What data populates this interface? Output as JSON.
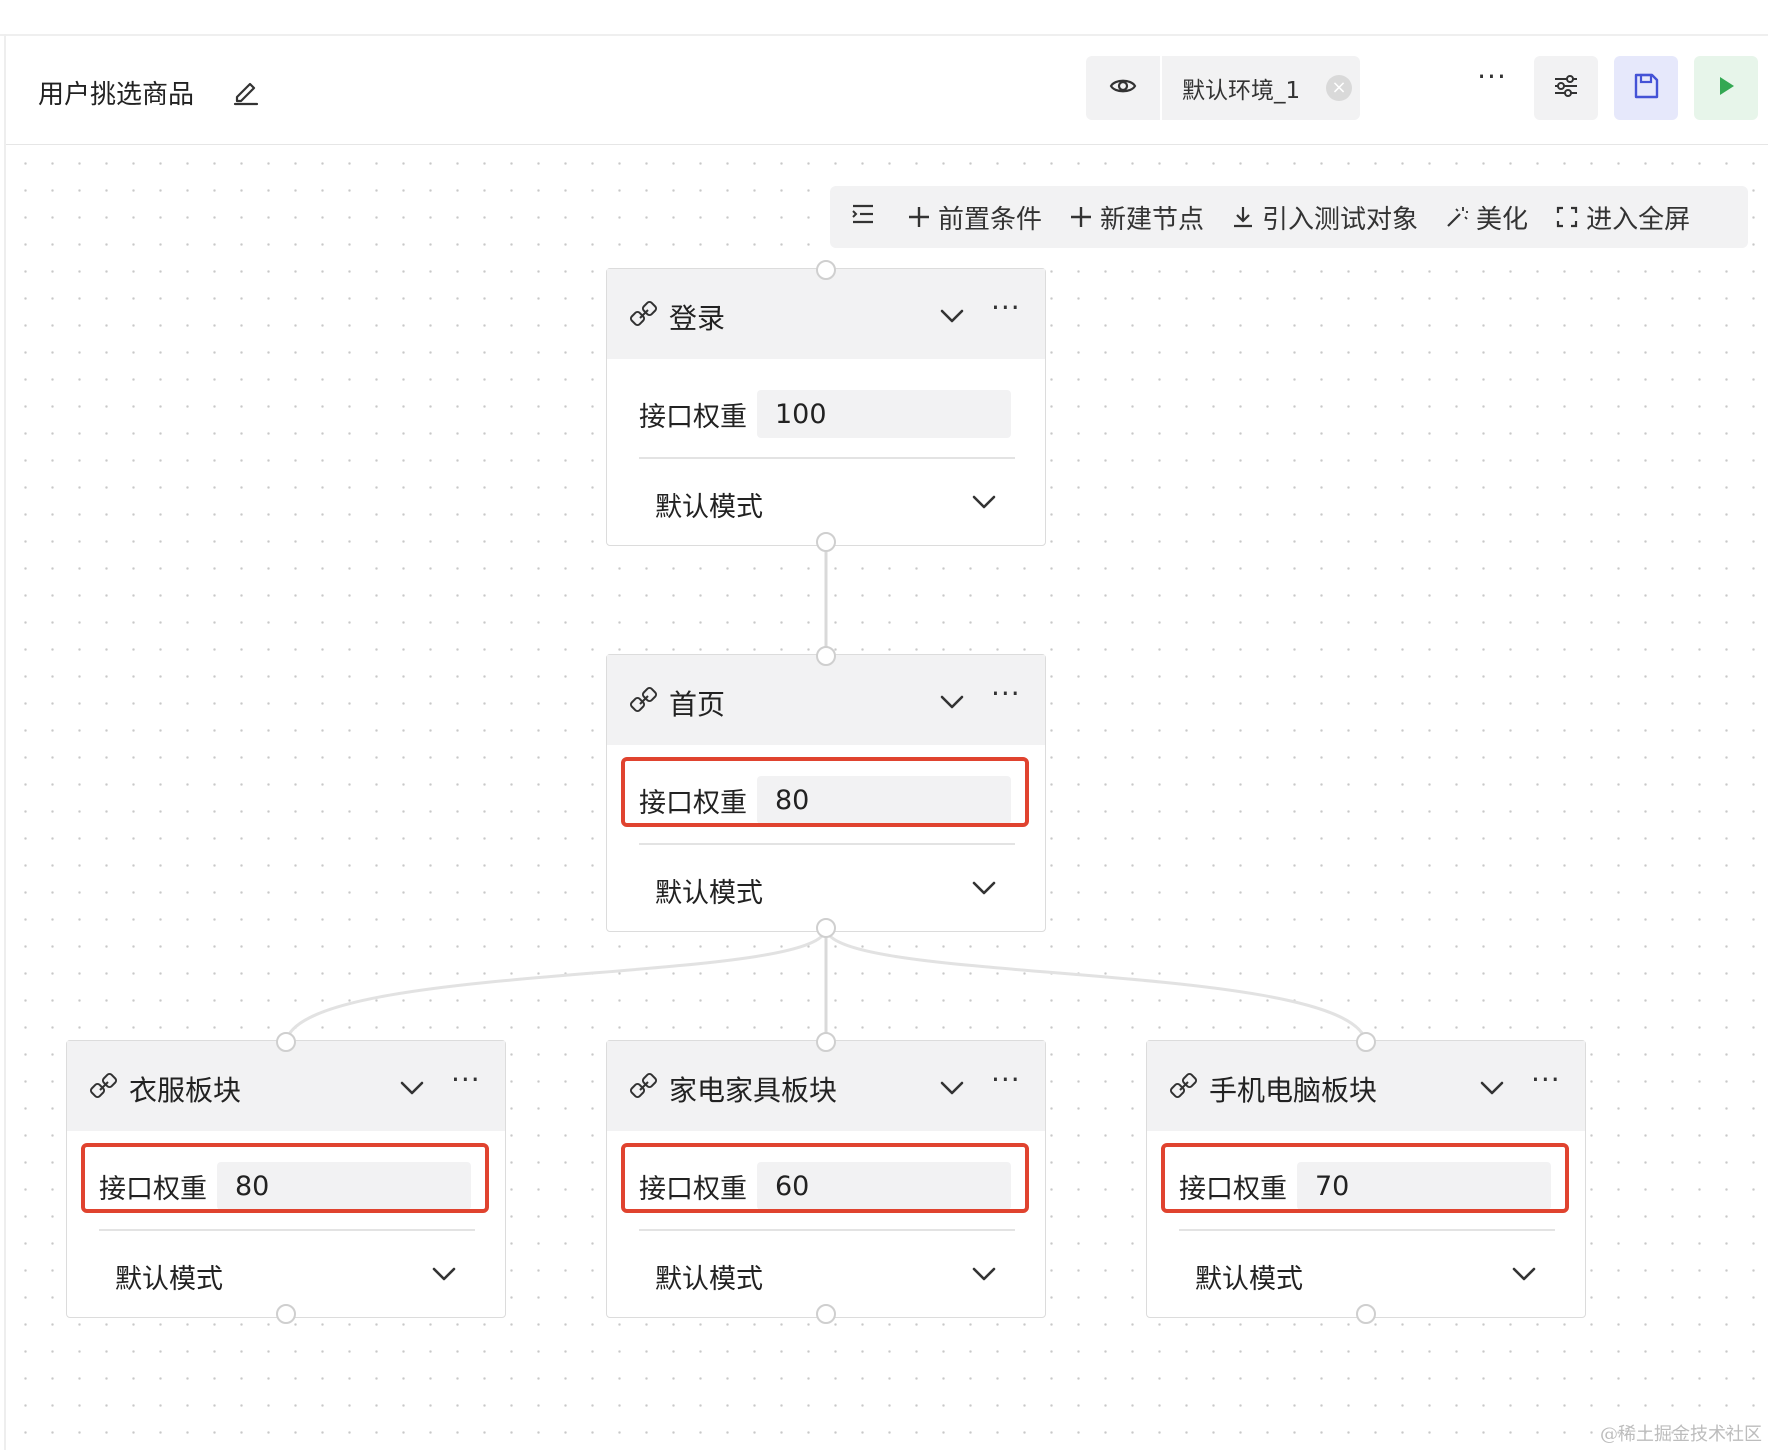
{
  "header": {
    "title": "用户挑选商品",
    "env_name": "默认环境_1",
    "env_clear": "×",
    "more": "···"
  },
  "toolbar": {
    "items": [
      {
        "label": "前置条件",
        "icon": "plus-icon"
      },
      {
        "label": "新建节点",
        "icon": "plus-icon"
      },
      {
        "label": "引入测试对象",
        "icon": "download-icon"
      },
      {
        "label": "美化",
        "icon": "magic-wand-icon"
      },
      {
        "label": "进入全屏",
        "icon": "fullscreen-icon"
      }
    ]
  },
  "nodes": [
    {
      "id": "login",
      "title": "登录",
      "weight_label": "接口权重",
      "weight": "100",
      "mode": "默认模式",
      "highlighted": false
    },
    {
      "id": "home",
      "title": "首页",
      "weight_label": "接口权重",
      "weight": "80",
      "mode": "默认模式",
      "highlighted": true
    },
    {
      "id": "clothes",
      "title": "衣服板块",
      "weight_label": "接口权重",
      "weight": "80",
      "mode": "默认模式",
      "highlighted": true
    },
    {
      "id": "appliances",
      "title": "家电家具板块",
      "weight_label": "接口权重",
      "weight": "60",
      "mode": "默认模式",
      "highlighted": true
    },
    {
      "id": "electronics",
      "title": "手机电脑板块",
      "weight_label": "接口权重",
      "weight": "70",
      "mode": "默认模式",
      "highlighted": true
    }
  ],
  "node_more": "···",
  "watermark": "@稀土掘金技术社区",
  "colors": {
    "highlight": "#e0432f",
    "save_accent": "#4452d6",
    "run_accent": "#34a853",
    "panel_bg": "#f2f2f3"
  }
}
